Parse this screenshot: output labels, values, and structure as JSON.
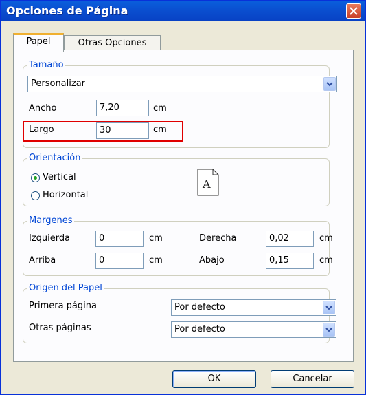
{
  "window": {
    "title": "Opciones de Página"
  },
  "tabs": [
    {
      "label": "Papel",
      "active": true
    },
    {
      "label": "Otras Opciones",
      "active": false
    }
  ],
  "size": {
    "group_label": "Tamaño",
    "preset": "Personalizar",
    "width_label": "Ancho",
    "width_value": "7,20",
    "width_unit": "cm",
    "length_label": "Largo",
    "length_value": "30",
    "length_unit": "cm"
  },
  "orientation": {
    "group_label": "Orientación",
    "vertical_label": "Vertical",
    "horizontal_label": "Horizontal",
    "selected": "Vertical",
    "preview_glyph": "A"
  },
  "margins": {
    "group_label": "Margenes",
    "left_label": "Izquierda",
    "left_value": "0",
    "left_unit": "cm",
    "right_label": "Derecha",
    "right_value": "0,02",
    "right_unit": "cm",
    "top_label": "Arriba",
    "top_value": "0",
    "top_unit": "cm",
    "bottom_label": "Abajo",
    "bottom_value": "0,15",
    "bottom_unit": "cm"
  },
  "paper_source": {
    "group_label": "Origen del Papel",
    "first_page_label": "Primera página",
    "first_page_value": "Por defecto",
    "other_pages_label": "Otras páginas",
    "other_pages_value": "Por defecto"
  },
  "buttons": {
    "ok": "OK",
    "cancel": "Cancelar"
  },
  "colors": {
    "titlebar": "#0a4fd0",
    "group_label": "#0046d5",
    "highlight": "#e00000",
    "radio_dot": "#21a121"
  }
}
